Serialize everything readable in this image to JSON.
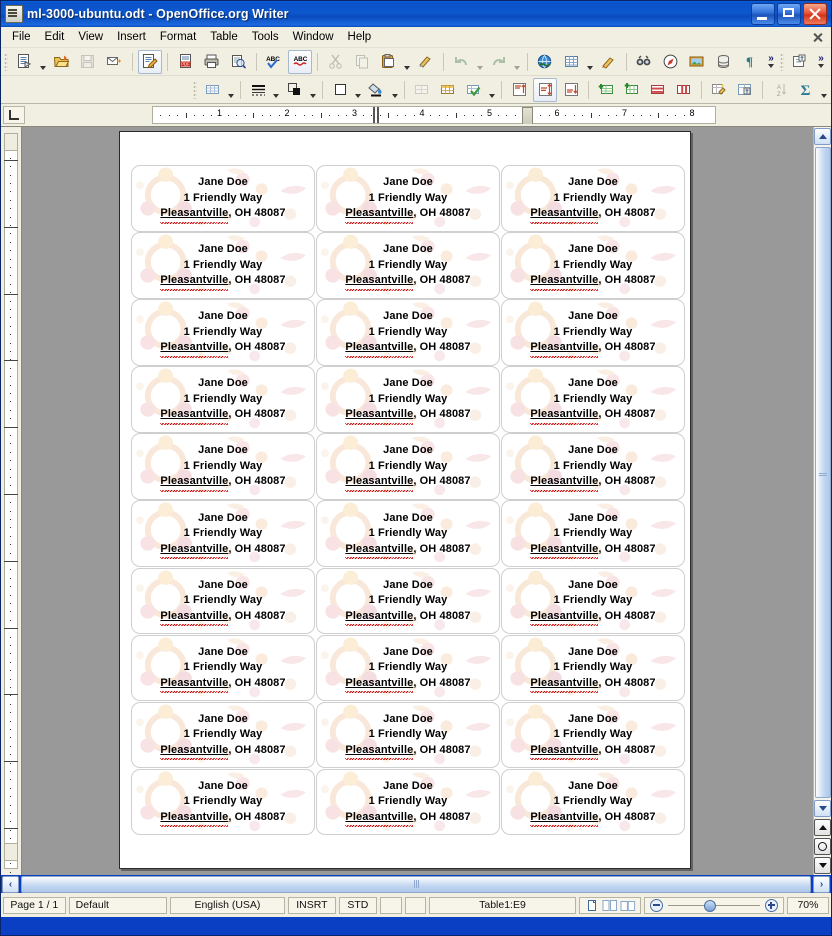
{
  "window": {
    "title": "ml-3000-ubuntu.odt - OpenOffice.org Writer",
    "icon": "writer-document-icon",
    "minimize": "minimize-button",
    "maximize": "maximize-button",
    "close": "close-button"
  },
  "menubar": {
    "items": [
      "File",
      "Edit",
      "View",
      "Insert",
      "Format",
      "Table",
      "Tools",
      "Window",
      "Help"
    ],
    "document_close": "×"
  },
  "toolbars": {
    "standard": [
      "new-document",
      "new-document-dropdown",
      "open",
      "save",
      "email",
      "edit-file",
      "export-pdf",
      "print",
      "print-preview",
      "spelling",
      "autocorrect",
      "cut",
      "copy",
      "paste",
      "paste-dropdown",
      "clone-formatting",
      "undo",
      "undo-dropdown",
      "redo",
      "redo-dropdown",
      "hyperlink",
      "insert-table",
      "insert-table-dropdown",
      "draw-functions",
      "find-replace",
      "navigator",
      "gallery",
      "data-sources",
      "formatting-marks",
      "overflow",
      "insert-field",
      "overflow2"
    ],
    "table": [
      "table-grid",
      "table-grid-dropdown",
      "line-style",
      "line-style-dropdown",
      "line-color",
      "line-color-dropdown",
      "borders",
      "borders-dropdown",
      "background-color",
      "background-color-dropdown",
      "merge-cells",
      "optimize",
      "align-top",
      "align-center-vertical",
      "align-bottom",
      "insert-row",
      "insert-column",
      "delete-row",
      "delete-column",
      "autoformat",
      "table-properties",
      "sort",
      "sum",
      "overflow"
    ]
  },
  "ruler": {
    "tab_selector": "tab-stop-left",
    "horizontal_marks": [
      "1",
      "2",
      "3",
      "4",
      "5",
      "6",
      "7",
      "8"
    ],
    "unit": "inch"
  },
  "document": {
    "label_text": {
      "name": "Jane Doe",
      "street": "1 Friendly Way",
      "city": "Pleasantville",
      "rest": ", OH  48087"
    },
    "watermark": "ubuntu-circle-of-friends-logo",
    "columns": 3,
    "rows": 10,
    "total_labels": 30,
    "misspelled_word": "Pleasantville"
  },
  "scrollbars": {
    "vertical": {
      "up": "scroll-up",
      "down": "scroll-down",
      "previous_page": "previous-page",
      "navigation": "navigation-dialog",
      "next_page": "next-page"
    },
    "horizontal": {
      "left": "‹",
      "right": "›"
    }
  },
  "statusbar": {
    "page": "Page 1 / 1",
    "page_style": "Default",
    "language": "English (USA)",
    "insert_mode": "INSRT",
    "selection_mode": "STD",
    "modified": "",
    "signature": "",
    "cell_reference": "Table1:E9",
    "view_layouts": [
      "single-page-view",
      "multi-page-view",
      "book-view"
    ],
    "zoom_out": "zoom-out",
    "zoom_in": "zoom-in",
    "zoom_level": "70%"
  },
  "colors": {
    "titlebar": "#0a52c8",
    "toolbar_bg": "#f1efe2",
    "workspace": "#999999",
    "page": "#ffffff",
    "accent": "#0a3fc4",
    "spellcheck": "#cc0000",
    "watermark_orange": "#e8a060"
  }
}
